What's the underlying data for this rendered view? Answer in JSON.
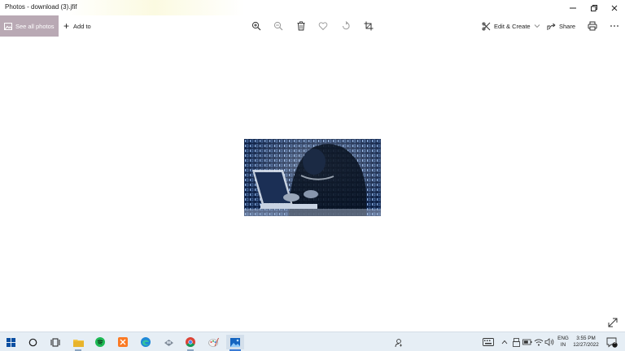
{
  "window": {
    "title": "Photos - download (3).jfif",
    "minimize_icon": "minimize-icon",
    "restore_icon": "restore-icon",
    "close_icon": "close-icon"
  },
  "toolbar": {
    "see_all_photos": "See all photos",
    "add_to": "Add to",
    "edit_create": "Edit & Create",
    "share": "Share",
    "icons": [
      "zoom-in-icon",
      "zoom-out-icon",
      "delete-icon",
      "favorite-icon",
      "rotate-icon",
      "crop-icon",
      "print-icon",
      "more-icon"
    ]
  },
  "photo": {
    "description_icon": "hacker-photo",
    "accent": "#3a6fb0"
  },
  "taskbar": {
    "apps": [
      "start-icon",
      "search-icon",
      "task-view-icon",
      "file-explorer-icon",
      "spotify-icon",
      "xampp-icon",
      "edge-icon",
      "app-icon",
      "chrome-icon",
      "paint-icon",
      "photos-icon"
    ],
    "tray": {
      "language_top": "ENG",
      "language_bottom": "IN",
      "time": "3:55 PM",
      "date": "12/27/2022",
      "notification_count": "5"
    }
  },
  "colors": {
    "see_all_bg": "#b9a9b4",
    "taskbar_bg": "#e6eef5"
  }
}
